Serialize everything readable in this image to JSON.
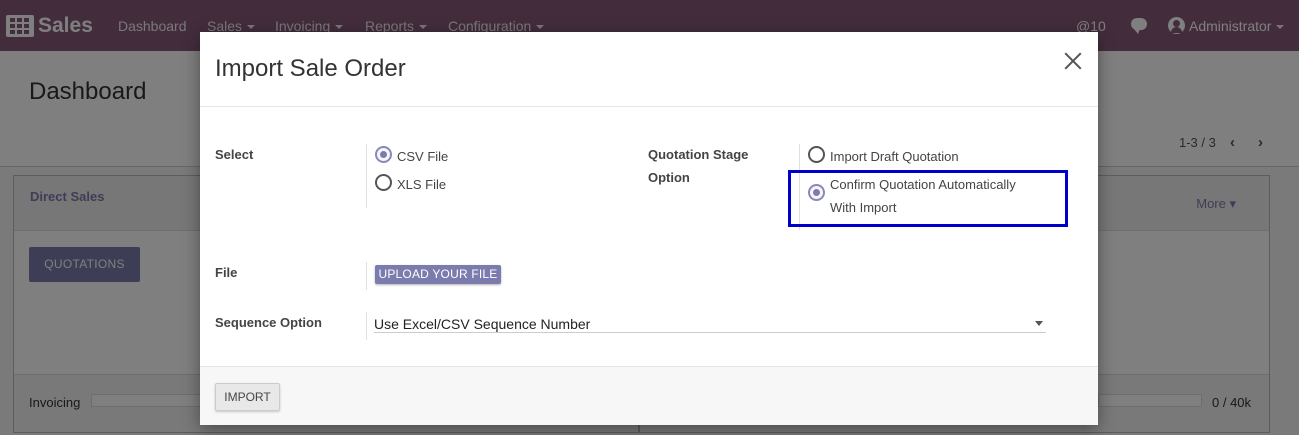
{
  "navbar": {
    "brand": "Sales",
    "items": [
      {
        "label": "Dashboard"
      },
      {
        "label": "Sales"
      },
      {
        "label": "Invoicing"
      },
      {
        "label": "Reports"
      },
      {
        "label": "Configuration"
      }
    ],
    "activity_count": "@10",
    "user": "Administrator",
    "background_color": "#875A7B"
  },
  "page": {
    "title": "Dashboard",
    "pager": "1-3 / 3"
  },
  "dashboard": {
    "card_title": "Direct Sales",
    "more_label": "More",
    "quotations_button": "QUOTATIONS",
    "invoicing_label": "Invoicing",
    "invoicing_value": "0 / 40k"
  },
  "modal": {
    "title": "Import Sale Order",
    "select_label": "Select",
    "select_options": [
      {
        "label": "CSV File",
        "checked": true
      },
      {
        "label": "XLS File",
        "checked": false
      }
    ],
    "stage_label_line1": "Quotation Stage",
    "stage_label_line2": "Option",
    "stage_options": [
      {
        "label": "Import Draft Quotation",
        "checked": false
      },
      {
        "label_line1": "Confirm Quotation Automatically",
        "label_line2": "With Import",
        "checked": true
      }
    ],
    "file_label": "File",
    "upload_button": "UPLOAD YOUR FILE",
    "sequence_label": "Sequence Option",
    "sequence_value": "Use Excel/CSV Sequence Number",
    "import_button": "IMPORT",
    "accent_color": "#7C7BAD",
    "highlight_color": "#0000CC"
  }
}
